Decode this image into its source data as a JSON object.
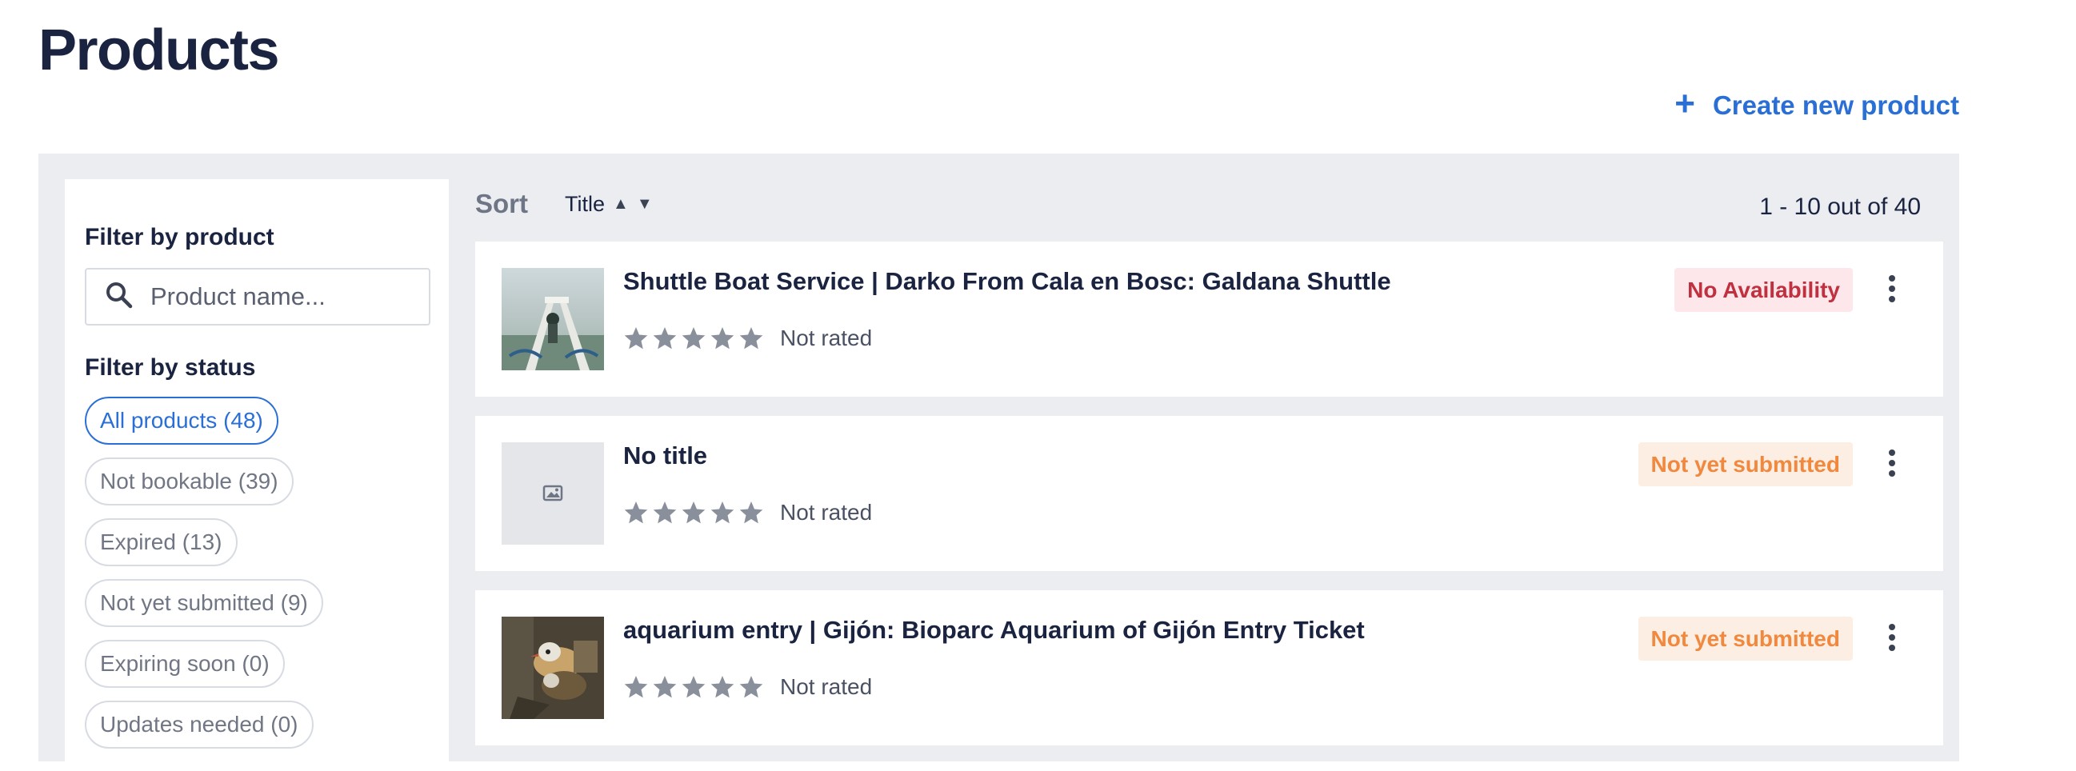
{
  "page": {
    "title": "Products"
  },
  "actions": {
    "create_label": "Create new product",
    "create_icon": "plus-icon"
  },
  "sidebar": {
    "filter_product_heading": "Filter by product",
    "search_placeholder": "Product name...",
    "filter_status_heading": "Filter by status",
    "statuses": [
      {
        "label": "All products (48)",
        "active": true
      },
      {
        "label": "Not bookable (39)",
        "active": false
      },
      {
        "label": "Expired (13)",
        "active": false
      },
      {
        "label": "Not yet submitted (9)",
        "active": false
      },
      {
        "label": "Expiring soon (0)",
        "active": false
      },
      {
        "label": "Updates needed (0)",
        "active": false
      }
    ]
  },
  "sort": {
    "label": "Sort",
    "field": "Title",
    "asc_icon": "▲",
    "desc_icon": "▼"
  },
  "pagination": {
    "range": "1 - 10 out of 40"
  },
  "products": [
    {
      "title": "Shuttle Boat Service | Darko From Cala en Bosc: Galdana Shuttle",
      "rating_text": "Not rated",
      "status": "No Availability",
      "status_color": "#c0303e",
      "status_bg": "#fde7ea",
      "thumbnail": "boat-photo"
    },
    {
      "title": "No title",
      "rating_text": "Not rated",
      "status": "Not yet submitted",
      "status_color": "#f0883e",
      "status_bg": "#fdeee3",
      "thumbnail": "image-placeholder-icon"
    },
    {
      "title": "aquarium entry | Gijón: Bioparc Aquarium of Gijón Entry Ticket",
      "rating_text": "Not rated",
      "status": "Not yet submitted",
      "status_color": "#f0883e",
      "status_bg": "#fdeee3",
      "thumbnail": "birds-photo"
    }
  ],
  "colors": {
    "accent": "#2a6fd6",
    "title": "#1a2340",
    "panel_bg": "#ebedf1",
    "star": "#8a8f9c"
  }
}
